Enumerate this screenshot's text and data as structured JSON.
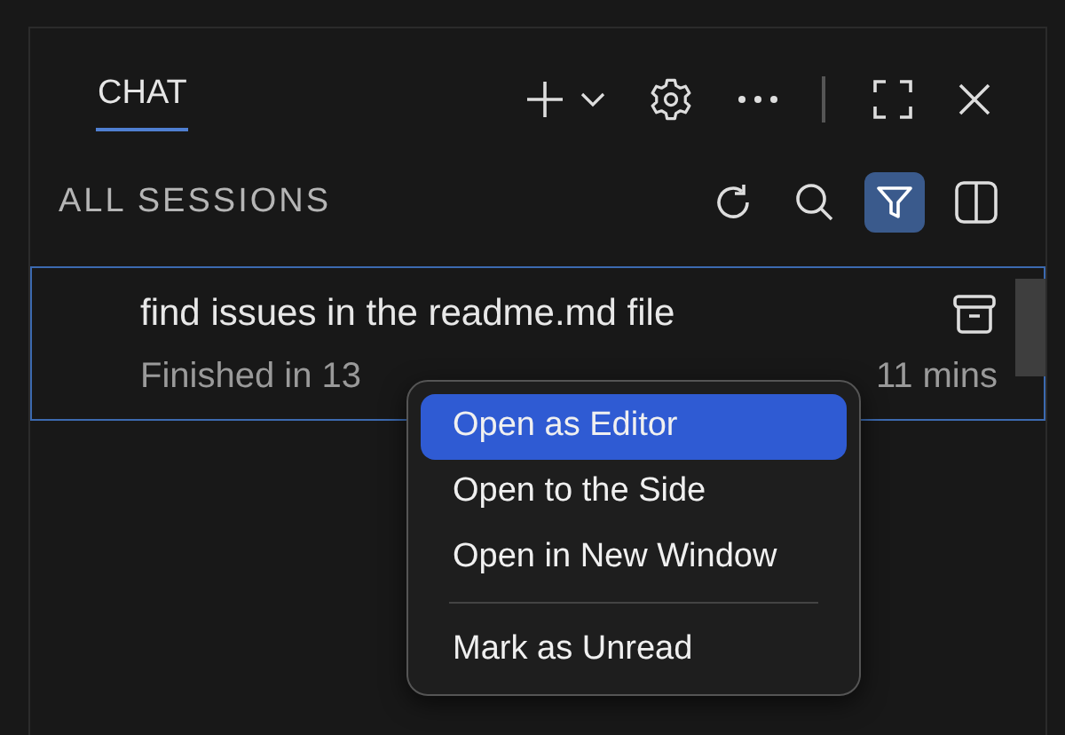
{
  "tabs": [
    {
      "label": "CHAT",
      "selected": true
    }
  ],
  "section": {
    "title": "ALL SESSIONS",
    "filter_active": true
  },
  "sessions": [
    {
      "title": "find issues in the readme.md file",
      "status": "Finished in 13",
      "time": "11 mins",
      "selected": true
    }
  ],
  "context_menu": {
    "items": [
      {
        "label": "Open as Editor",
        "selected": true
      },
      {
        "label": "Open to the Side",
        "selected": false
      },
      {
        "label": "Open in New Window",
        "selected": false
      },
      {
        "kind": "separator"
      },
      {
        "label": "Mark as Unread",
        "selected": false
      }
    ]
  }
}
